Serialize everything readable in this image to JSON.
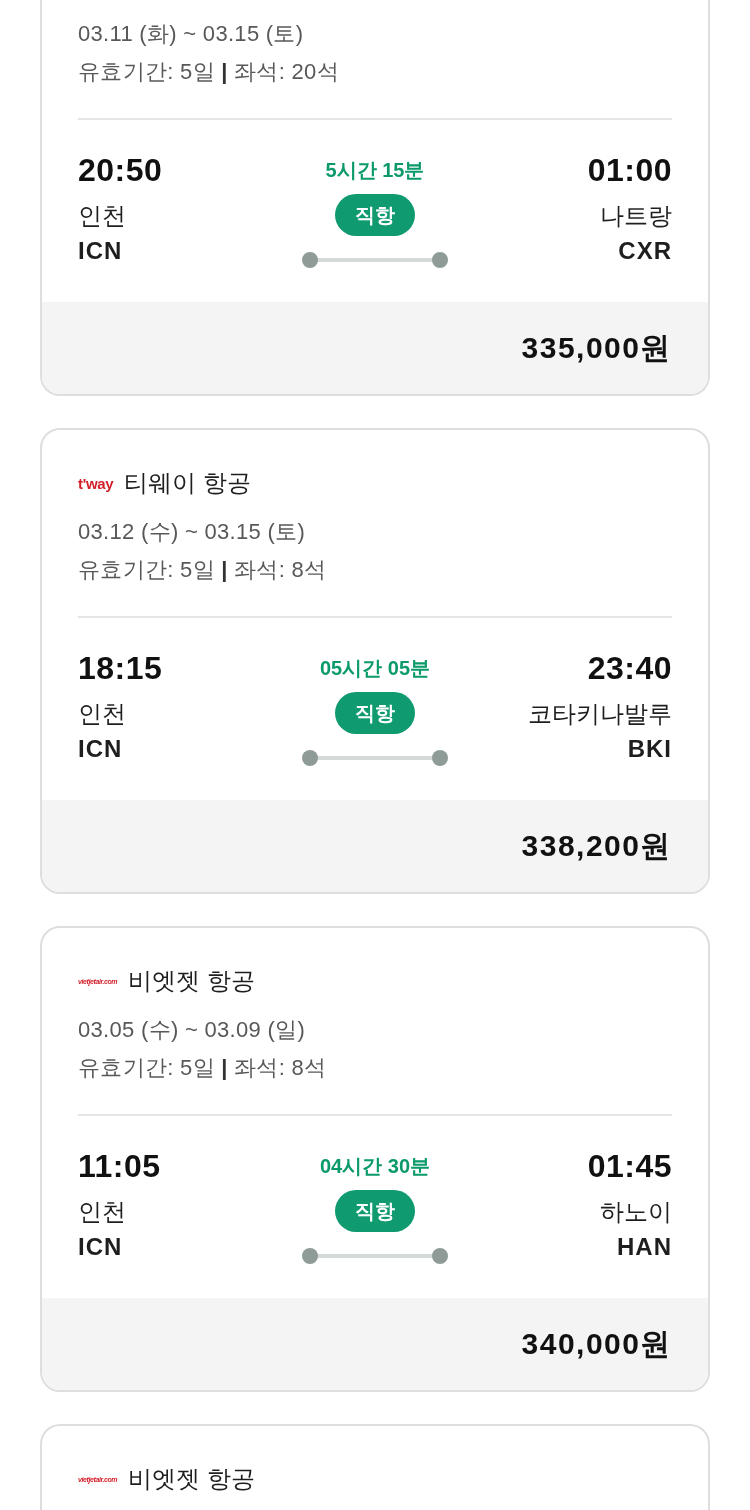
{
  "flights": [
    {
      "dates": "03.11 (화) ~ 03.15 (토)",
      "validity": "유효기간: 5일 **|** 좌석: 20석",
      "departure": {
        "time": "20:50",
        "city": "인천",
        "code": "ICN"
      },
      "duration": "5시간 15분",
      "badge": "직항",
      "arrival": {
        "time": "01:00",
        "city": "나트랑",
        "code": "CXR"
      },
      "price": "335,000원"
    },
    {
      "airline": {
        "logo": {
          "kind": "bold",
          "text": "t'way"
        },
        "name": "티웨이 항공"
      },
      "dates": "03.12 (수) ~ 03.15 (토)",
      "validity": "유효기간: 5일 **|** 좌석: 8석",
      "departure": {
        "time": "18:15",
        "city": "인천",
        "code": "ICN"
      },
      "duration": "05시간 05분",
      "badge": "직항",
      "arrival": {
        "time": "23:40",
        "city": "코타키나발루",
        "code": "BKI"
      },
      "price": "338,200원"
    },
    {
      "airline": {
        "logo": {
          "kind": "italic",
          "text": "vietjetair.com"
        },
        "name": "비엣젯 항공"
      },
      "dates": "03.05 (수) ~ 03.09 (일)",
      "validity": "유효기간: 5일 **|** 좌석: 8석",
      "departure": {
        "time": "11:05",
        "city": "인천",
        "code": "ICN"
      },
      "duration": "04시간 30분",
      "badge": "직항",
      "arrival": {
        "time": "01:45",
        "city": "하노이",
        "code": "HAN"
      },
      "price": "340,000원"
    },
    {
      "airline": {
        "logo": {
          "kind": "italic",
          "text": "vietjetair.com"
        },
        "name": "비엣젯 항공"
      }
    }
  ]
}
